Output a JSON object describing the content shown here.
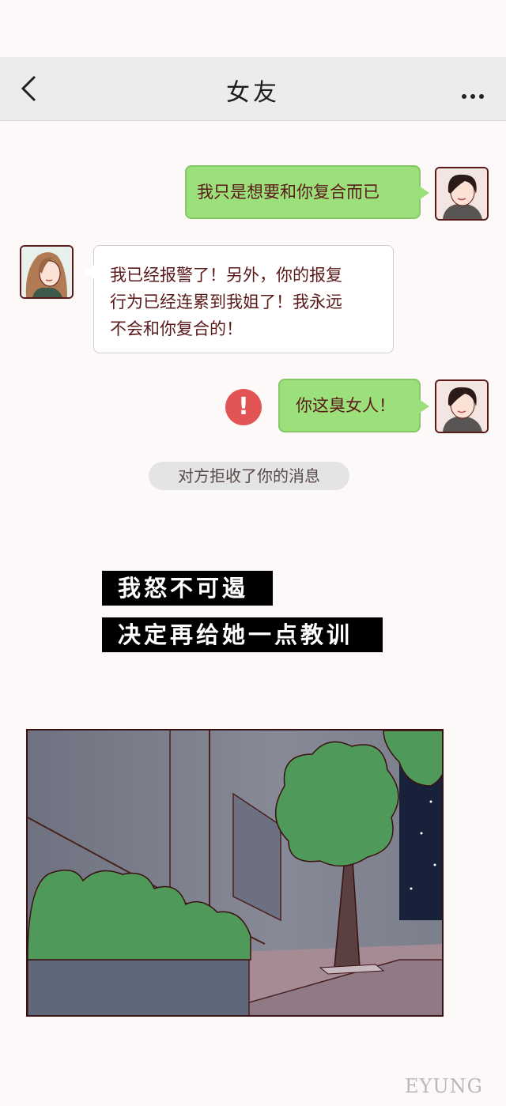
{
  "header": {
    "title": "女友",
    "back_icon": "chevron-left-icon",
    "more_icon": "more-dots-icon"
  },
  "messages": [
    {
      "sender": "me",
      "text": "我只是想要和你复合而已"
    },
    {
      "sender": "girlfriend",
      "lines": [
        "我已经报警了！另外，你的报复",
        "行为已经连累到我姐了！我永远",
        "不会和你复合的！"
      ]
    },
    {
      "sender": "me",
      "text": "你这臭女人！",
      "status": "failed"
    }
  ],
  "error_icon": {
    "glyph": "!",
    "color": "#e25454"
  },
  "system_notice": "对方拒收了你的消息",
  "captions": [
    "我怒不可遏",
    "决定再给她一点教训"
  ],
  "colors": {
    "bubble_me": "#9be07a",
    "bubble_other": "#ffffff",
    "text": "#5a1a1a"
  },
  "watermark": "EYUNG"
}
